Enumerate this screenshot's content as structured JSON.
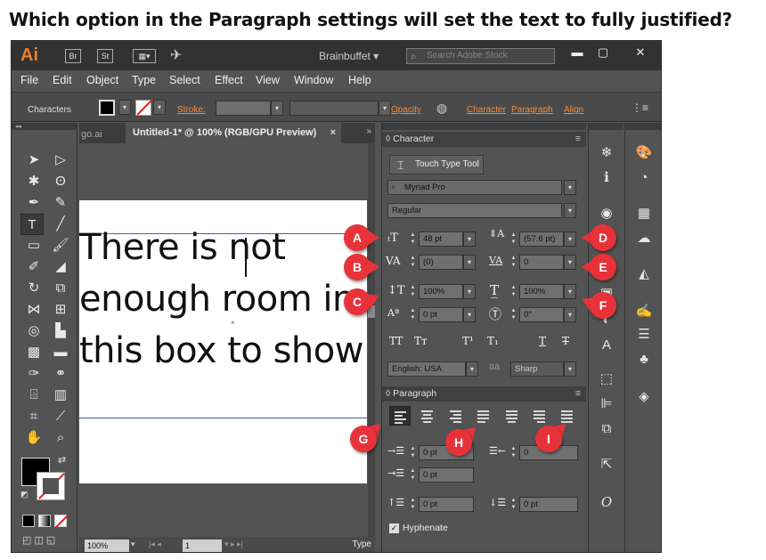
{
  "question": "Which option in the Paragraph settings will set the text to fully justified?",
  "titlebar": {
    "logo": "Ai",
    "br": "Br",
    "st": "St",
    "workspace": "Brainbuffet",
    "stock_placeholder": "Search Adobe Stock"
  },
  "menu": [
    "File",
    "Edit",
    "Object",
    "Type",
    "Select",
    "Effect",
    "View",
    "Window",
    "Help"
  ],
  "control": {
    "label": "Characters",
    "stroke": "Stroke:",
    "opacity": "Opacity",
    "character": "Character",
    "paragraph": "Paragraph",
    "align": "Align"
  },
  "document": {
    "tab_inactive": "go.ai",
    "tab_active": "Untitled-1* @ 100% (RGB/GPU Preview)",
    "tab_close": "×",
    "lines": [
      "There is not",
      "enough room in",
      "this box to show"
    ],
    "zoom": "100%",
    "page": "1",
    "status": "Type"
  },
  "character_panel": {
    "title": "Character",
    "touch_type": "Touch Type Tool",
    "font": "Myriad Pro",
    "style": "Regular",
    "font_size": "48 pt",
    "leading": "(57.6 pt)",
    "kerning": "(0)",
    "tracking": "0",
    "vscale": "100%",
    "hscale": "100%",
    "baseline": "0 pt",
    "rotation": "0°",
    "language": "English: USA",
    "aa_label": "a",
    "antialias": "Sharp"
  },
  "paragraph_panel": {
    "title": "Paragraph",
    "left_indent": "0 pt",
    "right_indent": "0",
    "first_indent": "0 pt",
    "space_before": "0 pt",
    "space_after": "0 pt",
    "hyphenate": "Hyphenate"
  },
  "callouts": [
    "A",
    "B",
    "C",
    "D",
    "E",
    "F",
    "G",
    "H",
    "I"
  ]
}
